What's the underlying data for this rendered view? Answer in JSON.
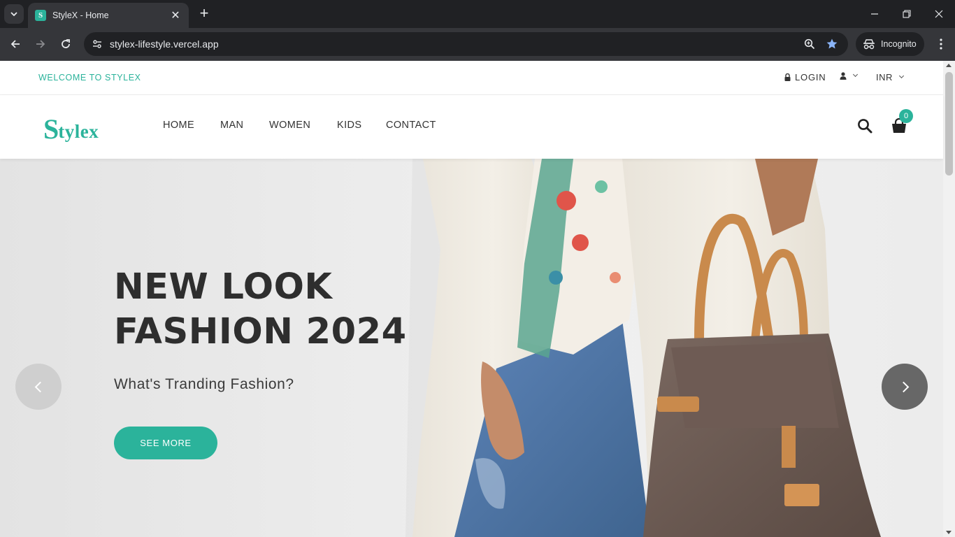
{
  "browser": {
    "tab_title": "StyleX - Home",
    "favicon_letter": "S",
    "url": "stylex-lifestyle.vercel.app",
    "incognito_label": "Incognito"
  },
  "topbar": {
    "welcome": "WELCOME TO STYLEX",
    "login": "LOGIN",
    "currency": "INR"
  },
  "header": {
    "logo_initial": "S",
    "logo_rest": "tylex",
    "menu": [
      {
        "label": "HOME"
      },
      {
        "label": "MAN"
      },
      {
        "label": "WOMEN"
      },
      {
        "label": "KIDS"
      },
      {
        "label": "CONTACT"
      }
    ],
    "cart_count": "0"
  },
  "hero": {
    "title_line1": "NEW LOOK",
    "title_line2": "FASHION 2024",
    "subtitle": "What's Tranding Fashion?",
    "button": "SEE MORE"
  },
  "colors": {
    "accent": "#2bb39b",
    "text_dark": "#2e2e2e",
    "browser_bg": "#202124",
    "browser_toolbar": "#35363a"
  }
}
